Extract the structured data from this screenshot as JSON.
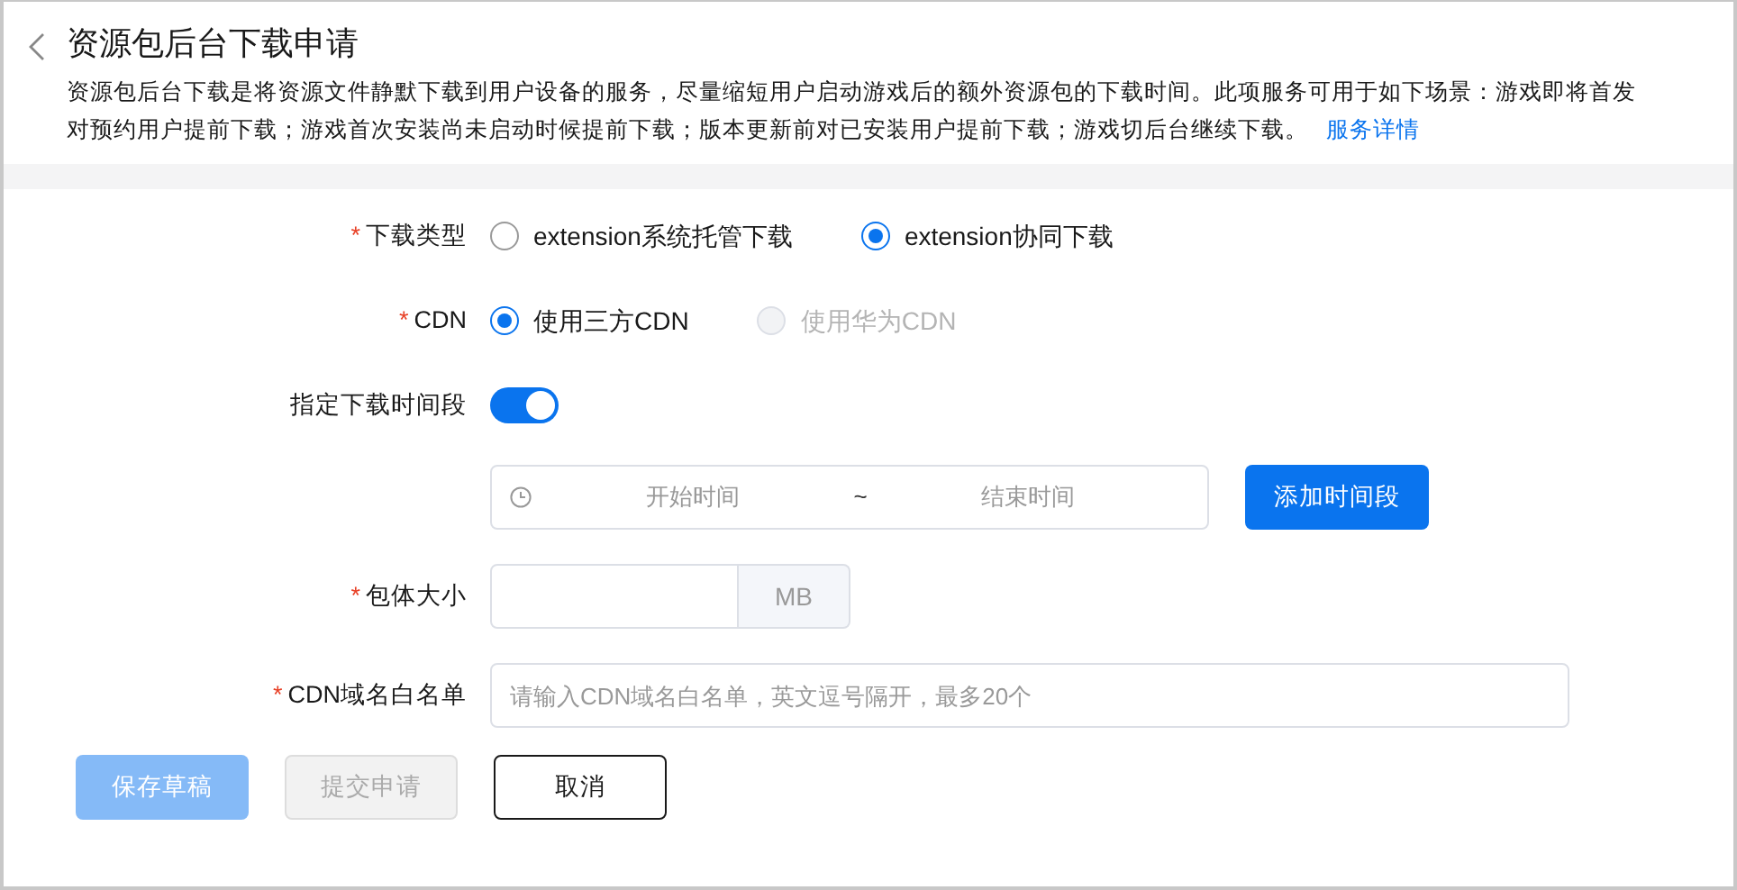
{
  "header": {
    "title": "资源包后台下载申请",
    "description": "资源包后台下载是将资源文件静默下载到用户设备的服务，尽量缩短用户启动游戏后的额外资源包的下载时间。此项服务可用于如下场景：游戏即将首发对预约用户提前下载；游戏首次安装尚未启动时候提前下载；版本更新前对已安装用户提前下载；游戏切后台继续下载。",
    "link": "服务详情"
  },
  "form": [
    {
      "kind": "radio",
      "label": "下载类型",
      "required_mark": "*",
      "options": [
        {
          "label": "extension系统托管下载",
          "selected": false,
          "disabled": false
        },
        {
          "label": "extension协同下载",
          "selected": true,
          "disabled": false
        }
      ]
    },
    {
      "kind": "radio",
      "label": "CDN",
      "required_mark": "*",
      "options": [
        {
          "label": "使用三方CDN",
          "selected": true,
          "disabled": false
        },
        {
          "label": "使用华为CDN",
          "selected": false,
          "disabled": true
        }
      ]
    },
    {
      "kind": "switch",
      "label": "指定下载时间段",
      "on": true
    },
    {
      "kind": "time_range",
      "start_placeholder": "开始时间",
      "separator": "~",
      "end_placeholder": "结束时间",
      "button": "添加时间段"
    },
    {
      "kind": "size",
      "label": "包体大小",
      "required_mark": "*",
      "unit": "MB"
    },
    {
      "kind": "text",
      "label": "CDN域名白名单",
      "required_mark": "*",
      "placeholder": "请输入CDN域名白名单，英文逗号隔开，最多20个"
    }
  ],
  "buttons": [
    {
      "label": "保存草稿",
      "kind": "primary",
      "disabled": true
    },
    {
      "label": "提交申请",
      "kind": "secondary",
      "disabled": true
    },
    {
      "label": "取消",
      "kind": "outline",
      "disabled": false
    }
  ]
}
